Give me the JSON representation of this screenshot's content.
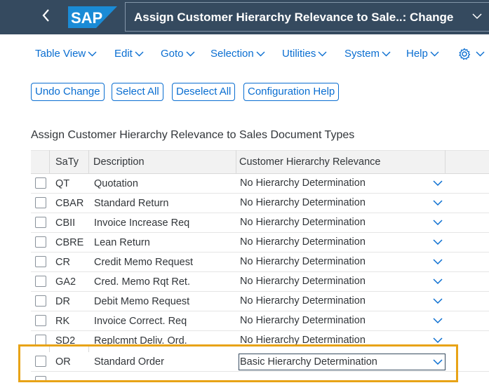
{
  "header": {
    "logo_text": "SAP",
    "title": "Assign Customer Hierarchy Relevance to Sale..: Change",
    "brand_color": "#354a5f",
    "logo_color": "#1a8bd6"
  },
  "menu": {
    "items": [
      "Table View",
      "Edit",
      "Goto",
      "Selection",
      "Utilities",
      "System",
      "Help"
    ],
    "settings_icon": "gear-icon"
  },
  "toolbar": {
    "buttons": [
      "Undo Change",
      "Select All",
      "Deselect All",
      "Configuration Help"
    ]
  },
  "section": {
    "title": "Assign Customer Hierarchy Relevance to Sales Document Types"
  },
  "table": {
    "columns": [
      "SaTy",
      "Description",
      "Customer Hierarchy Relevance"
    ],
    "rows": [
      {
        "code": "QT",
        "description": "Quotation",
        "relevance": "No Hierarchy Determination"
      },
      {
        "code": "CBAR",
        "description": "Standard Return",
        "relevance": "No Hierarchy Determination"
      },
      {
        "code": "CBII",
        "description": "Invoice Increase Req",
        "relevance": "No Hierarchy Determination"
      },
      {
        "code": "CBRE",
        "description": "Lean Return",
        "relevance": "No Hierarchy Determination"
      },
      {
        "code": "CR",
        "description": "Credit Memo Request",
        "relevance": "No Hierarchy Determination"
      },
      {
        "code": "GA2",
        "description": "Cred. Memo Rqt Ret.",
        "relevance": "No Hierarchy Determination"
      },
      {
        "code": "DR",
        "description": "Debit Memo Request",
        "relevance": "No Hierarchy Determination"
      },
      {
        "code": "RK",
        "description": "Invoice Correct. Req",
        "relevance": "No Hierarchy Determination"
      },
      {
        "code": "SD2",
        "description": "Replcmnt Deliv. Ord.",
        "relevance": "No Hierarchy Determination"
      },
      {
        "code": "OR",
        "description": "Standard Order",
        "relevance": "Basic Hierarchy Determination"
      }
    ]
  },
  "colors": {
    "link": "#0a6ed1",
    "highlight": "#e8a317"
  }
}
